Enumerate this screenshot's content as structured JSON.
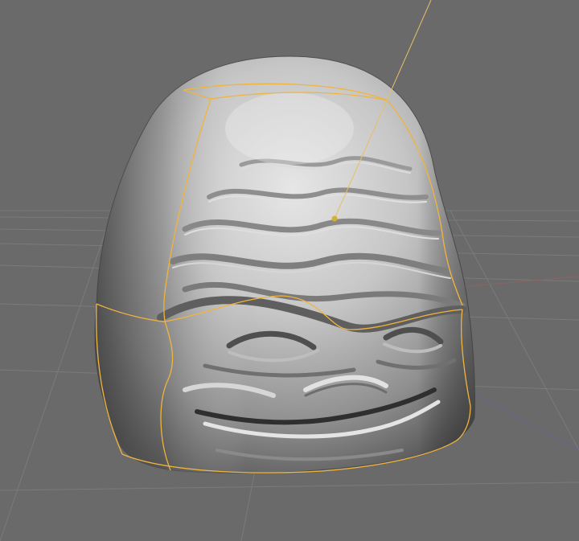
{
  "viewport": {
    "background_color": "#6a6a6a",
    "grid_color": "#7b7b7b",
    "axis_x_color": "#8a6464",
    "axis_z_color": "#66668f",
    "selection_color": "#f0b43c"
  },
  "scene": {
    "object_kind": "sculpted-head",
    "light_icon": "light-gizmo-icon"
  }
}
